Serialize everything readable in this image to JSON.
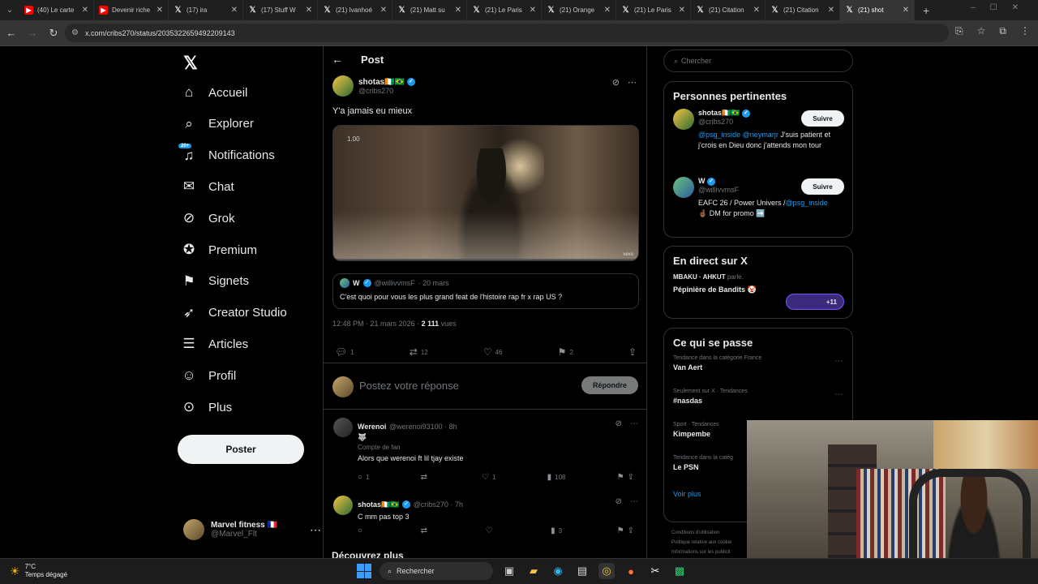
{
  "browser": {
    "tabs": [
      {
        "title": "(40) Le carte",
        "icon": "youtube-icon",
        "active": false
      },
      {
        "title": "Devenir riche",
        "icon": "youtube-icon",
        "active": false
      },
      {
        "title": "(17) ira",
        "icon": "x-icon",
        "active": false
      },
      {
        "title": "(17) Stuff W",
        "icon": "x-icon",
        "active": false
      },
      {
        "title": "(21) Ivanhoé",
        "icon": "x-icon",
        "active": false
      },
      {
        "title": "(21) Matt su",
        "icon": "x-icon",
        "active": false
      },
      {
        "title": "(21) Le Paris",
        "icon": "x-icon",
        "active": false
      },
      {
        "title": "(21) Orange",
        "icon": "x-icon",
        "active": false
      },
      {
        "title": "(21) Le Paris",
        "icon": "x-icon",
        "active": false
      },
      {
        "title": "(21) Citation",
        "icon": "x-icon",
        "active": false
      },
      {
        "title": "(21) Citation",
        "icon": "x-icon",
        "active": false
      },
      {
        "title": "(21) shot",
        "icon": "x-icon",
        "active": true
      }
    ],
    "url": "x.com/cribs270/status/2035322659492209143"
  },
  "sidebar": {
    "items": [
      {
        "label": "Accueil",
        "icon": "home-icon"
      },
      {
        "label": "Explorer",
        "icon": "search-icon"
      },
      {
        "label": "Notifications",
        "icon": "bell-icon",
        "badge": "20+"
      },
      {
        "label": "Chat",
        "icon": "mail-icon"
      },
      {
        "label": "Grok",
        "icon": "grok-icon"
      },
      {
        "label": "Premium",
        "icon": "premium-icon"
      },
      {
        "label": "Signets",
        "icon": "bookmark-icon"
      },
      {
        "label": "Creator Studio",
        "icon": "rocket-icon"
      },
      {
        "label": "Articles",
        "icon": "article-icon"
      },
      {
        "label": "Profil",
        "icon": "person-icon"
      },
      {
        "label": "Plus",
        "icon": "more-circle-icon"
      }
    ],
    "post_button": "Poster",
    "account": {
      "name": "Marvel fitness 🇫🇷",
      "handle": "@Marvel_Flt"
    }
  },
  "main": {
    "header_title": "Post",
    "tweet": {
      "author_name": "shotas🇨🇮🇧🇷",
      "author_handle": "@cribs270",
      "text": "Y'a jamais eu mieux",
      "video_speed": "1.00",
      "video_watermark": "vevo",
      "quote": {
        "name": "W",
        "handle": "@willivvmsF",
        "date": "· 20 mars",
        "text": "C'est quoi pour vous les plus grand feat de l'histoire rap fr x rap US ?"
      },
      "time": "12:48 PM · 21 mars 2026 · ",
      "views_count": "2 111",
      "views_label": " vues",
      "stats": {
        "replies": "1",
        "retweets": "12",
        "likes": "46",
        "bookmarks": "2"
      }
    },
    "reply_placeholder": "Postez votre réponse",
    "reply_button": "Répondre",
    "replies": [
      {
        "name": "Werenoi",
        "handle": "@werenoi93100 · 8h",
        "emoji": "🐺",
        "subtitle": "Compte de fan",
        "text": "Alors que werenoi ft lil tjay existe",
        "stats": {
          "replies": "1",
          "retweets": "",
          "likes": "1",
          "views": "108"
        }
      },
      {
        "name": "shotas🇨🇮🇧🇷",
        "handle": "@cribs270 · 7h",
        "text": "C mm pas top 3",
        "stats": {
          "replies": "",
          "retweets": "",
          "likes": "",
          "views": "3"
        }
      }
    ],
    "discover": "Découvrez plus"
  },
  "right": {
    "search_placeholder": "Chercher",
    "relevant_title": "Personnes pertinentes",
    "people": [
      {
        "name": "shotas🇨🇮🇧🇷",
        "handle": "@cribs270",
        "bio_link": "@psg_inside @neymarjr",
        "bio": " J'suis patient et j'crois en Dieu donc j'attends mon tour",
        "follow": "Suivre"
      },
      {
        "name": "W",
        "handle": "@willivvmsF",
        "bio": "EAFC 26 / Power Univers /",
        "bio_link": "@psg_inside",
        "bio2": "🤞🏾 DM for promo ➡️",
        "follow": "Suivre"
      }
    ],
    "live_title": "En direct sur X",
    "live_hosts": "MBAKU · AHKUT",
    "live_speaking": " parle.",
    "live_name": "Pépinière de Bandits 🤡",
    "live_count": "+11",
    "trends_title": "Ce qui se passe",
    "trends": [
      {
        "category": "Tendance dans la catégorie France",
        "name": "Van Aert"
      },
      {
        "category": "Seulement sur X · Tendances",
        "name": "#nasdas"
      },
      {
        "category": "Sport · Tendances",
        "name": "Kimpembe"
      },
      {
        "category": "Tendance dans la catég",
        "name": "Le PSN"
      }
    ],
    "show_more": "Voir plus",
    "footer": [
      "Conditions d'utilisation",
      "Politique relative aux cookie",
      "Informations sur les publicit"
    ]
  },
  "taskbar": {
    "temp": "7°C",
    "weather": "Temps dégagé",
    "search": "Rechercher"
  }
}
